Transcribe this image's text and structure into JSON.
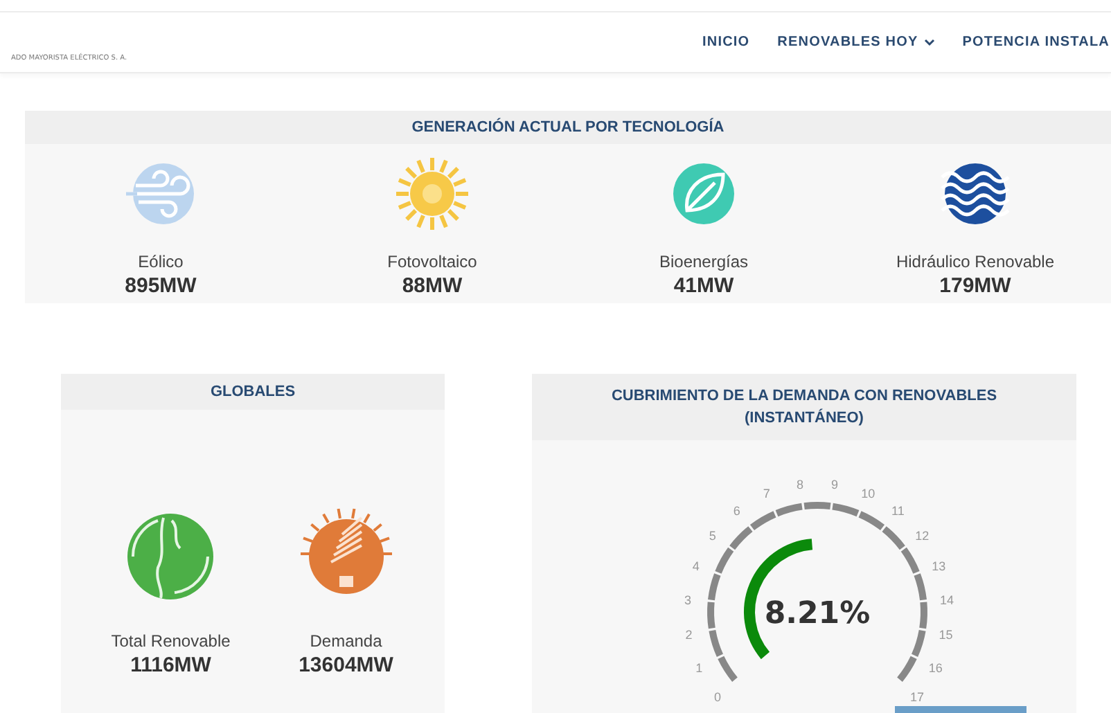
{
  "header": {
    "logo_text": "ADO MAYORISTA ELÉCTRICO S. A.",
    "nav": [
      {
        "label": "INICIO",
        "dropdown": false
      },
      {
        "label": "RENOVABLES HOY",
        "dropdown": true
      },
      {
        "label": "POTENCIA INSTALA",
        "dropdown": false
      }
    ]
  },
  "generation": {
    "title": "GENERACIÓN ACTUAL POR TECNOLOGÍA",
    "items": [
      {
        "kind": "wind",
        "label": "Eólico",
        "value": "895MW"
      },
      {
        "kind": "solar",
        "label": "Fotovoltaico",
        "value": "88MW"
      },
      {
        "kind": "bio",
        "label": "Bioenergías",
        "value": "41MW"
      },
      {
        "kind": "hydro",
        "label": "Hidráulico Renovable",
        "value": "179MW"
      }
    ]
  },
  "globals": {
    "title": "GLOBALES",
    "items": [
      {
        "kind": "globe",
        "label": "Total Renovable",
        "value": "1116MW"
      },
      {
        "kind": "bulb",
        "label": "Demanda",
        "value": "13604MW"
      }
    ]
  },
  "coverage": {
    "title": "CUBRIMIENTO DE LA DEMANDA CON RENOVABLES (INSTANTÁNEO)",
    "reading": "8.21%",
    "ticks": [
      "0",
      "1",
      "2",
      "3",
      "4",
      "5",
      "6",
      "7",
      "8",
      "9",
      "10",
      "11",
      "12",
      "13",
      "14",
      "15",
      "16",
      "17"
    ]
  }
}
